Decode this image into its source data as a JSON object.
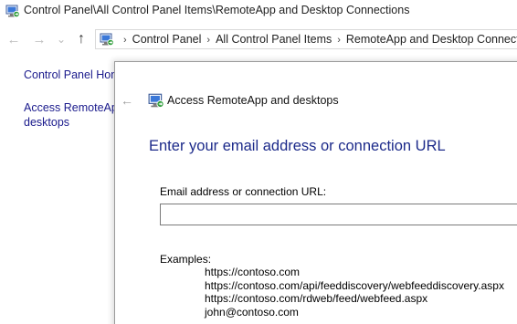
{
  "window": {
    "title": "Control Panel\\All Control Panel Items\\RemoteApp and Desktop Connections",
    "icon": "remoteapp-connections-icon"
  },
  "nav": {
    "back_glyph": "←",
    "forward_glyph": "→",
    "recent_glyph": "⌄",
    "up_glyph": "↑"
  },
  "address": {
    "crumbs": [
      "Control Panel",
      "All Control Panel Items",
      "RemoteApp and Desktop Connections"
    ],
    "separator": "›"
  },
  "left_pane": {
    "home_link": "Control Panel Home",
    "access_link_line1": "Access RemoteApp and",
    "access_link_line2": "desktops"
  },
  "dialog": {
    "back_glyph": "←",
    "title": "Access RemoteApp and desktops",
    "heading": "Enter your email address or connection URL",
    "field_label": "Email address or connection URL:",
    "field_value": "",
    "examples_label": "Examples:",
    "examples": [
      "https://contoso.com",
      "https://contoso.com/api/feeddiscovery/webfeeddiscovery.aspx",
      "https://contoso.com/rdweb/feed/webfeed.aspx",
      "john@contoso.com"
    ]
  },
  "colors": {
    "heading": "#1c2a8a",
    "link": "#1a1a8c",
    "border": "#9a9a9a"
  }
}
